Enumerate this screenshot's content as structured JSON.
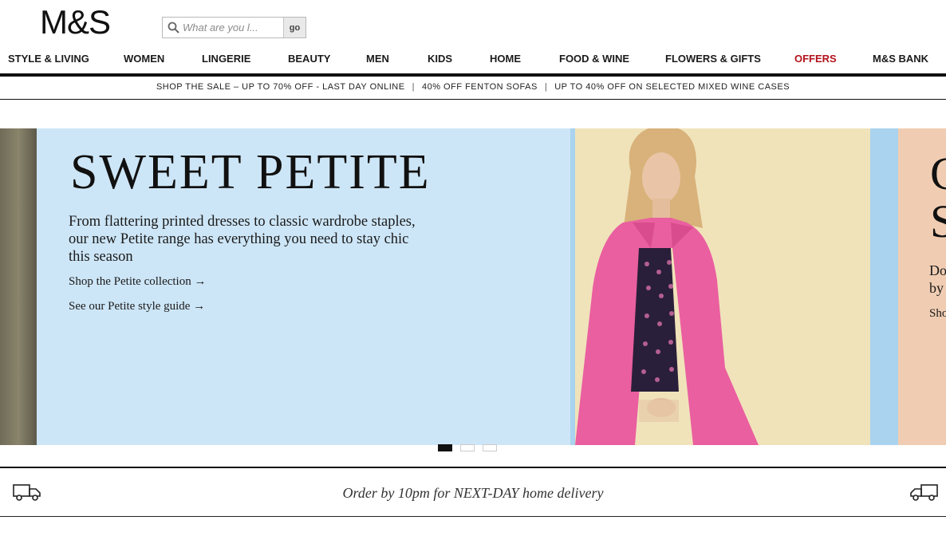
{
  "brand": {
    "logo": "M&S"
  },
  "search": {
    "placeholder": "What are you l...",
    "go_label": "go",
    "icon": "search-icon"
  },
  "nav": {
    "items": [
      {
        "label": "STYLE & LIVING"
      },
      {
        "label": "WOMEN"
      },
      {
        "label": "LINGERIE"
      },
      {
        "label": "BEAUTY"
      },
      {
        "label": "MEN"
      },
      {
        "label": "KIDS"
      },
      {
        "label": "HOME"
      },
      {
        "label": "FOOD & WINE"
      },
      {
        "label": "FLOWERS & GIFTS"
      },
      {
        "label": "OFFERS",
        "color": "#b3121b"
      },
      {
        "label": "M&S BANK"
      }
    ]
  },
  "promo": {
    "items": [
      "SHOP THE SALE – UP TO 70% OFF - LAST DAY ONLINE",
      "40% OFF FENTON SOFAS",
      "UP TO 40% OFF ON SELECTED MIXED WINE CASES"
    ],
    "separator": "|"
  },
  "hero": {
    "title": "SWEET PETITE",
    "description": "From flattering printed dresses to classic wardrobe staples, our new Petite range has everything you need to stay chic this season",
    "links": [
      "Shop the Petite collection →",
      "See our Petite style guide →"
    ],
    "next_slide": {
      "big_1": "C",
      "big_2": "S",
      "line_1": "Do",
      "line_2": "by",
      "link": "Sho"
    },
    "colors": {
      "panel": "#cde6f7",
      "coat": "#ea5fa0"
    }
  },
  "carousel": {
    "slide_count": 3,
    "active_index": 0
  },
  "delivery": {
    "text_before": "Order by 10pm for ",
    "text_emphasis": "NEXT-DAY",
    "text_after": " home delivery",
    "icon": "delivery-truck-icon"
  }
}
